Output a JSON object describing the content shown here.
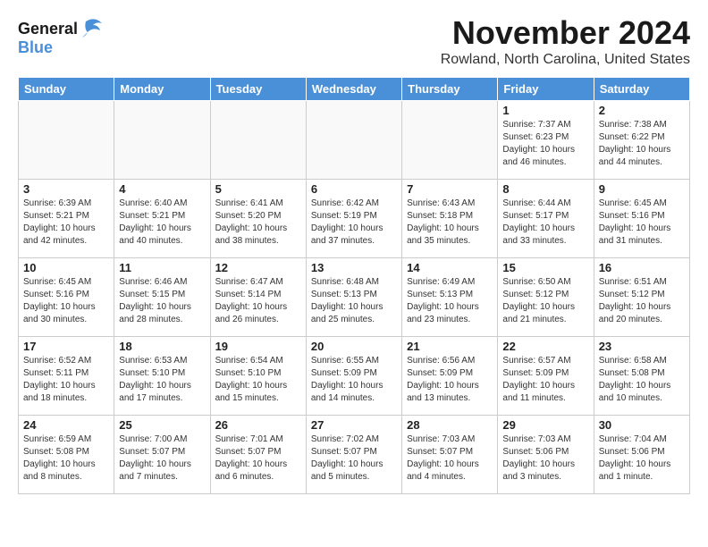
{
  "header": {
    "logo_line1": "General",
    "logo_line2": "Blue",
    "month": "November 2024",
    "location": "Rowland, North Carolina, United States"
  },
  "weekdays": [
    "Sunday",
    "Monday",
    "Tuesday",
    "Wednesday",
    "Thursday",
    "Friday",
    "Saturday"
  ],
  "weeks": [
    [
      {
        "day": "",
        "info": ""
      },
      {
        "day": "",
        "info": ""
      },
      {
        "day": "",
        "info": ""
      },
      {
        "day": "",
        "info": ""
      },
      {
        "day": "",
        "info": ""
      },
      {
        "day": "1",
        "info": "Sunrise: 7:37 AM\nSunset: 6:23 PM\nDaylight: 10 hours\nand 46 minutes."
      },
      {
        "day": "2",
        "info": "Sunrise: 7:38 AM\nSunset: 6:22 PM\nDaylight: 10 hours\nand 44 minutes."
      }
    ],
    [
      {
        "day": "3",
        "info": "Sunrise: 6:39 AM\nSunset: 5:21 PM\nDaylight: 10 hours\nand 42 minutes."
      },
      {
        "day": "4",
        "info": "Sunrise: 6:40 AM\nSunset: 5:21 PM\nDaylight: 10 hours\nand 40 minutes."
      },
      {
        "day": "5",
        "info": "Sunrise: 6:41 AM\nSunset: 5:20 PM\nDaylight: 10 hours\nand 38 minutes."
      },
      {
        "day": "6",
        "info": "Sunrise: 6:42 AM\nSunset: 5:19 PM\nDaylight: 10 hours\nand 37 minutes."
      },
      {
        "day": "7",
        "info": "Sunrise: 6:43 AM\nSunset: 5:18 PM\nDaylight: 10 hours\nand 35 minutes."
      },
      {
        "day": "8",
        "info": "Sunrise: 6:44 AM\nSunset: 5:17 PM\nDaylight: 10 hours\nand 33 minutes."
      },
      {
        "day": "9",
        "info": "Sunrise: 6:45 AM\nSunset: 5:16 PM\nDaylight: 10 hours\nand 31 minutes."
      }
    ],
    [
      {
        "day": "10",
        "info": "Sunrise: 6:45 AM\nSunset: 5:16 PM\nDaylight: 10 hours\nand 30 minutes."
      },
      {
        "day": "11",
        "info": "Sunrise: 6:46 AM\nSunset: 5:15 PM\nDaylight: 10 hours\nand 28 minutes."
      },
      {
        "day": "12",
        "info": "Sunrise: 6:47 AM\nSunset: 5:14 PM\nDaylight: 10 hours\nand 26 minutes."
      },
      {
        "day": "13",
        "info": "Sunrise: 6:48 AM\nSunset: 5:13 PM\nDaylight: 10 hours\nand 25 minutes."
      },
      {
        "day": "14",
        "info": "Sunrise: 6:49 AM\nSunset: 5:13 PM\nDaylight: 10 hours\nand 23 minutes."
      },
      {
        "day": "15",
        "info": "Sunrise: 6:50 AM\nSunset: 5:12 PM\nDaylight: 10 hours\nand 21 minutes."
      },
      {
        "day": "16",
        "info": "Sunrise: 6:51 AM\nSunset: 5:12 PM\nDaylight: 10 hours\nand 20 minutes."
      }
    ],
    [
      {
        "day": "17",
        "info": "Sunrise: 6:52 AM\nSunset: 5:11 PM\nDaylight: 10 hours\nand 18 minutes."
      },
      {
        "day": "18",
        "info": "Sunrise: 6:53 AM\nSunset: 5:10 PM\nDaylight: 10 hours\nand 17 minutes."
      },
      {
        "day": "19",
        "info": "Sunrise: 6:54 AM\nSunset: 5:10 PM\nDaylight: 10 hours\nand 15 minutes."
      },
      {
        "day": "20",
        "info": "Sunrise: 6:55 AM\nSunset: 5:09 PM\nDaylight: 10 hours\nand 14 minutes."
      },
      {
        "day": "21",
        "info": "Sunrise: 6:56 AM\nSunset: 5:09 PM\nDaylight: 10 hours\nand 13 minutes."
      },
      {
        "day": "22",
        "info": "Sunrise: 6:57 AM\nSunset: 5:09 PM\nDaylight: 10 hours\nand 11 minutes."
      },
      {
        "day": "23",
        "info": "Sunrise: 6:58 AM\nSunset: 5:08 PM\nDaylight: 10 hours\nand 10 minutes."
      }
    ],
    [
      {
        "day": "24",
        "info": "Sunrise: 6:59 AM\nSunset: 5:08 PM\nDaylight: 10 hours\nand 8 minutes."
      },
      {
        "day": "25",
        "info": "Sunrise: 7:00 AM\nSunset: 5:07 PM\nDaylight: 10 hours\nand 7 minutes."
      },
      {
        "day": "26",
        "info": "Sunrise: 7:01 AM\nSunset: 5:07 PM\nDaylight: 10 hours\nand 6 minutes."
      },
      {
        "day": "27",
        "info": "Sunrise: 7:02 AM\nSunset: 5:07 PM\nDaylight: 10 hours\nand 5 minutes."
      },
      {
        "day": "28",
        "info": "Sunrise: 7:03 AM\nSunset: 5:07 PM\nDaylight: 10 hours\nand 4 minutes."
      },
      {
        "day": "29",
        "info": "Sunrise: 7:03 AM\nSunset: 5:06 PM\nDaylight: 10 hours\nand 3 minutes."
      },
      {
        "day": "30",
        "info": "Sunrise: 7:04 AM\nSunset: 5:06 PM\nDaylight: 10 hours\nand 1 minute."
      }
    ]
  ]
}
